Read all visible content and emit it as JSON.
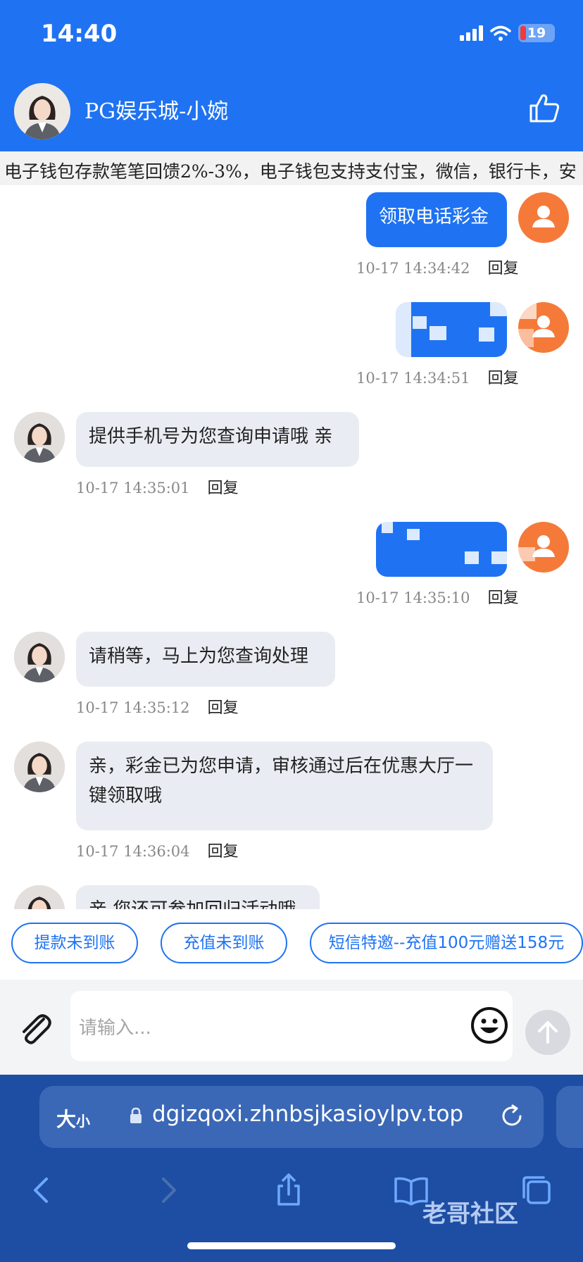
{
  "status": {
    "time": "14:40",
    "battery": "19"
  },
  "header": {
    "title": "PG娱乐城-小婉"
  },
  "marquee": {
    "text": "电子钱包存款笔笔回馈2%-3%，电子钱包支持支付宝，微信，银行卡，安"
  },
  "messages": [
    {
      "from": "user",
      "text": "领取电话彩金",
      "time": "10-17 14:34:42",
      "reply": "回复"
    },
    {
      "from": "user",
      "text": "",
      "time": "10-17 14:34:51",
      "reply": "回复"
    },
    {
      "from": "agent",
      "text": "提供手机号为您查询申请哦 亲",
      "time": "10-17 14:35:01",
      "reply": "回复"
    },
    {
      "from": "user",
      "text": "",
      "time": "10-17 14:35:10",
      "reply": "回复"
    },
    {
      "from": "agent",
      "text": "请稍等，马上为您查询处理",
      "time": "10-17 14:35:12",
      "reply": "回复"
    },
    {
      "from": "agent",
      "text": "亲，彩金已为您申请，审核通过后在优惠大厅一键领取哦",
      "time": "10-17 14:36:04",
      "reply": "回复"
    },
    {
      "from": "agent",
      "text": "亲 您还可参加回归活动哦",
      "time": "",
      "reply": ""
    }
  ],
  "quick_replies": [
    "提款未到账",
    "充值未到账",
    "短信特邀--充值100元赠送158元"
  ],
  "input": {
    "placeholder": "请输入..."
  },
  "browser": {
    "text_size": "大",
    "text_size_small": "小",
    "url": "dgizqoxi.zhnbsjkasioylpv.top"
  },
  "watermark": "老哥社区",
  "colors": {
    "primary": "#1f73f2",
    "user_avatar": "#f57a3a",
    "agent_bubble": "#e9ecf2",
    "browser": "#1d4ea3"
  }
}
